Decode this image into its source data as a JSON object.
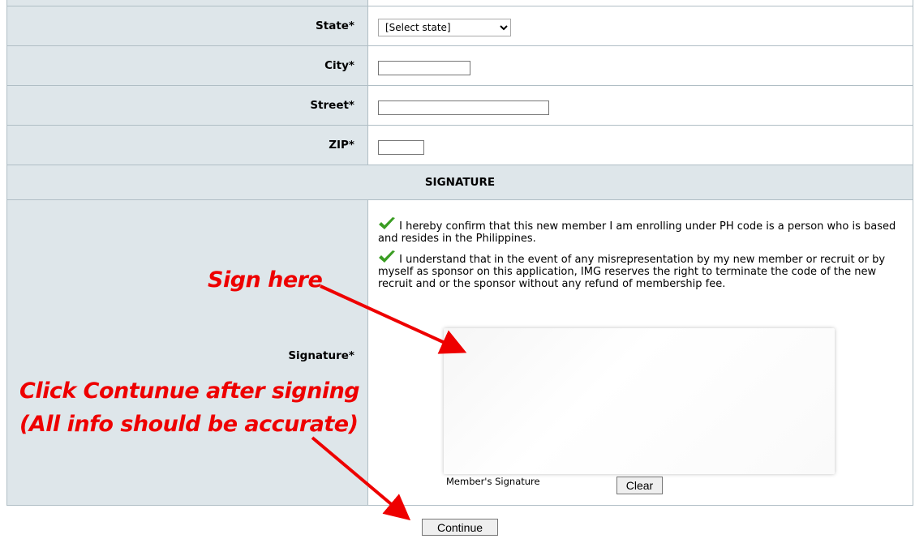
{
  "form": {
    "state": {
      "label": "State*",
      "selected": "[Select state]"
    },
    "city": {
      "label": "City*",
      "value": ""
    },
    "street": {
      "label": "Street*",
      "value": ""
    },
    "zip": {
      "label": "ZIP*",
      "value": ""
    },
    "signature_section": {
      "heading": "SIGNATURE"
    },
    "confirmations": [
      "I hereby confirm that this new member I am enrolling under PH code is a person who is based and resides in the Philippines.",
      "I understand that in the event of any misrepresentation by my new member or recruit or by myself as sponsor on this application, IMG reserves the right to terminate the code of the new recruit and or the sponsor without any refund of membership fee."
    ],
    "signature": {
      "label": "Signature*",
      "caption": "Member's Signature",
      "clear_label": "Clear"
    },
    "continue_label": "Continue"
  },
  "annotations": {
    "sign_here": "Sign here",
    "click_continue_line1": "Click Contunue after signing",
    "click_continue_line2": "(All info should be accurate)",
    "color": "#ee0000"
  },
  "colors": {
    "label_bg": "#dee6ea",
    "border": "#b0bec5",
    "check": "#3a9d23"
  }
}
